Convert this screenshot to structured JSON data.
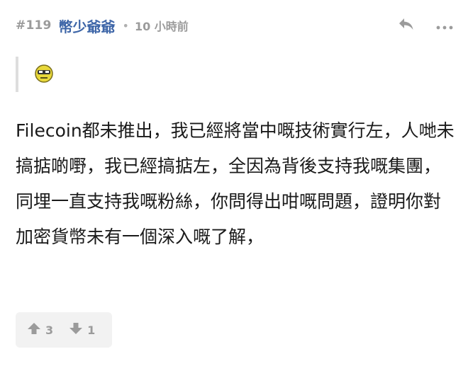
{
  "post": {
    "number": "#119",
    "username": "幣少爺爺",
    "separator": "•",
    "time": "10 小時前",
    "quote_emoji_icon": "sunglasses-emoji-icon",
    "content": "Filecoin都未推出，我已經將當中嘅技術實行左，人哋未搞掂啲嘢，我已經搞掂左，全因為背後支持我嘅集團，同埋一直支持我嘅粉絲，你問得出咁嘅問題，證明你對加密貨幣未有一個深入嘅了解，",
    "upvotes": "3",
    "downvotes": "1"
  },
  "icons": {
    "reply": "reply-icon",
    "more": "more-icon",
    "upvote": "thumb-up-arrow-icon",
    "downvote": "thumb-down-arrow-icon"
  },
  "colors": {
    "username": "#3e66a8",
    "meta": "#9b9b9b",
    "vote_bg": "#f2f2f2",
    "quote_bar": "#dedede"
  }
}
